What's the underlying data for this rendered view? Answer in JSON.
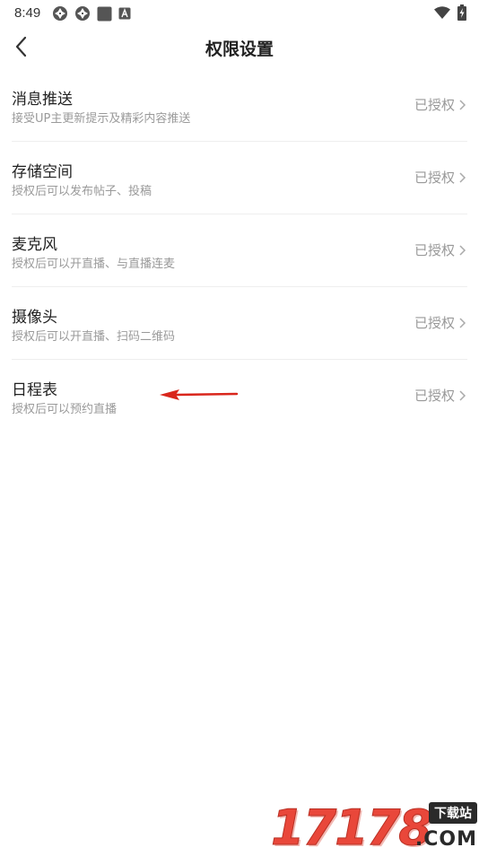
{
  "status_bar": {
    "time": "8:49",
    "icons_left": [
      "aperture-icon",
      "aperture-icon",
      "square-app-icon",
      "a-badge-icon"
    ],
    "icons_right": [
      "wifi-icon",
      "battery-charging-icon"
    ]
  },
  "header": {
    "title": "权限设置",
    "back_icon": "chevron-left-icon"
  },
  "permissions": [
    {
      "name": "消息推送",
      "desc": "接受UP主更新提示及精彩内容推送",
      "status": "已授权"
    },
    {
      "name": "存储空间",
      "desc": "授权后可以发布帖子、投稿",
      "status": "已授权"
    },
    {
      "name": "麦克风",
      "desc": "授权后可以开直播、与直播连麦",
      "status": "已授权"
    },
    {
      "name": "摄像头",
      "desc": "授权后可以开直播、扫码二维码",
      "status": "已授权"
    },
    {
      "name": "日程表",
      "desc": "授权后可以预约直播",
      "status": "已授权"
    }
  ],
  "annotation": {
    "color": "#d9261c"
  },
  "watermark": {
    "digits": "17178",
    "badge": "下载站",
    "suffix": ".COM"
  },
  "colors": {
    "accent_red": "#e9473a",
    "text_primary": "#222222",
    "text_secondary": "#9a9a9a",
    "divider": "#eeeeee"
  }
}
